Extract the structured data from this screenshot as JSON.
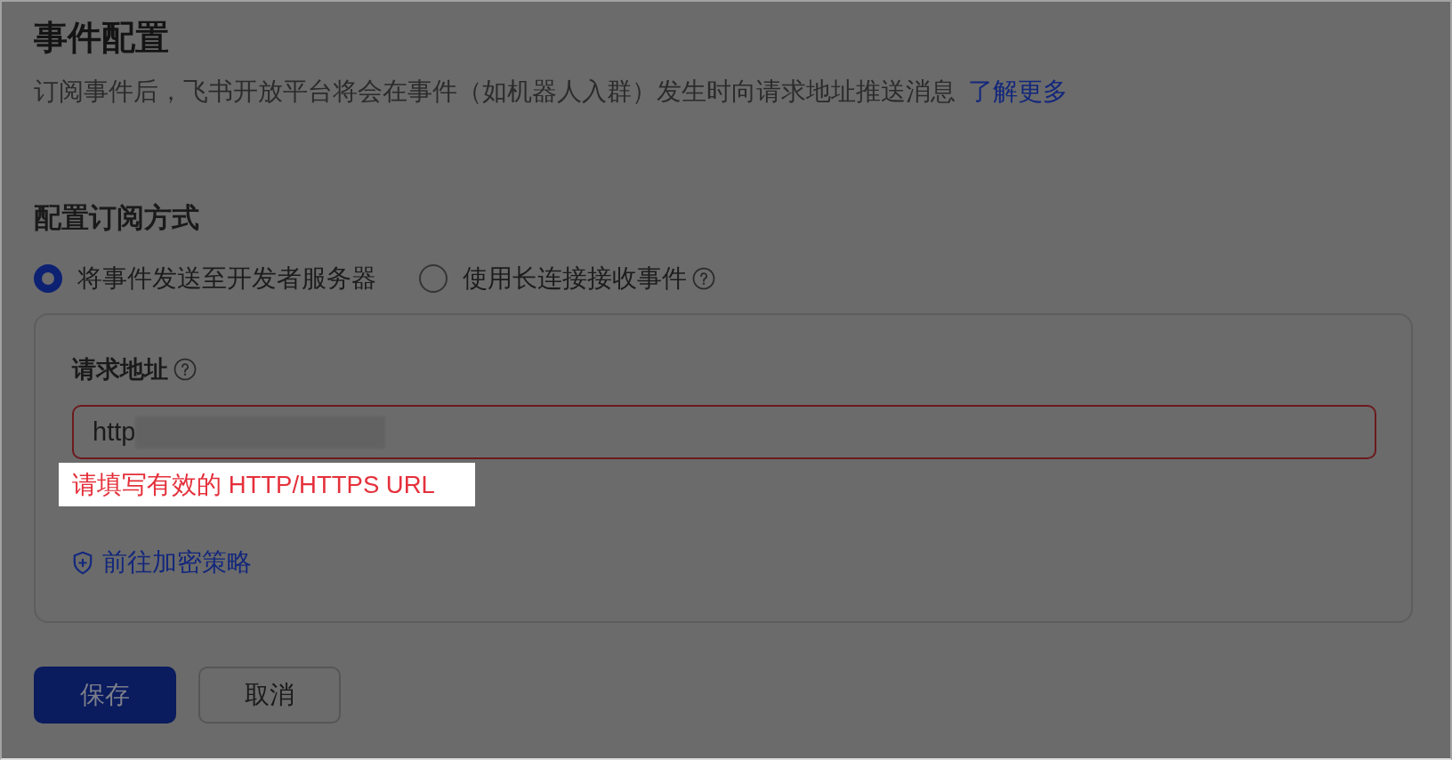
{
  "header": {
    "title": "事件配置",
    "description": "订阅事件后，飞书开放平台将会在事件（如机器人入群）发生时向请求地址推送消息",
    "link": "了解更多"
  },
  "subscription": {
    "heading": "配置订阅方式",
    "options": [
      {
        "label": "将事件发送至开发者服务器",
        "selected": true,
        "help": false
      },
      {
        "label": "使用长连接接收事件",
        "selected": false,
        "help": true
      }
    ]
  },
  "card": {
    "field": {
      "label": "请求地址",
      "help": true,
      "value": "http",
      "redacted": true,
      "error": "请填写有效的 HTTP/HTTPS URL",
      "highlighted": true
    },
    "link": "前往加密策略"
  },
  "buttons": [
    {
      "label": "保存",
      "kind": "primary"
    },
    {
      "label": "取消",
      "kind": "secondary"
    }
  ]
}
